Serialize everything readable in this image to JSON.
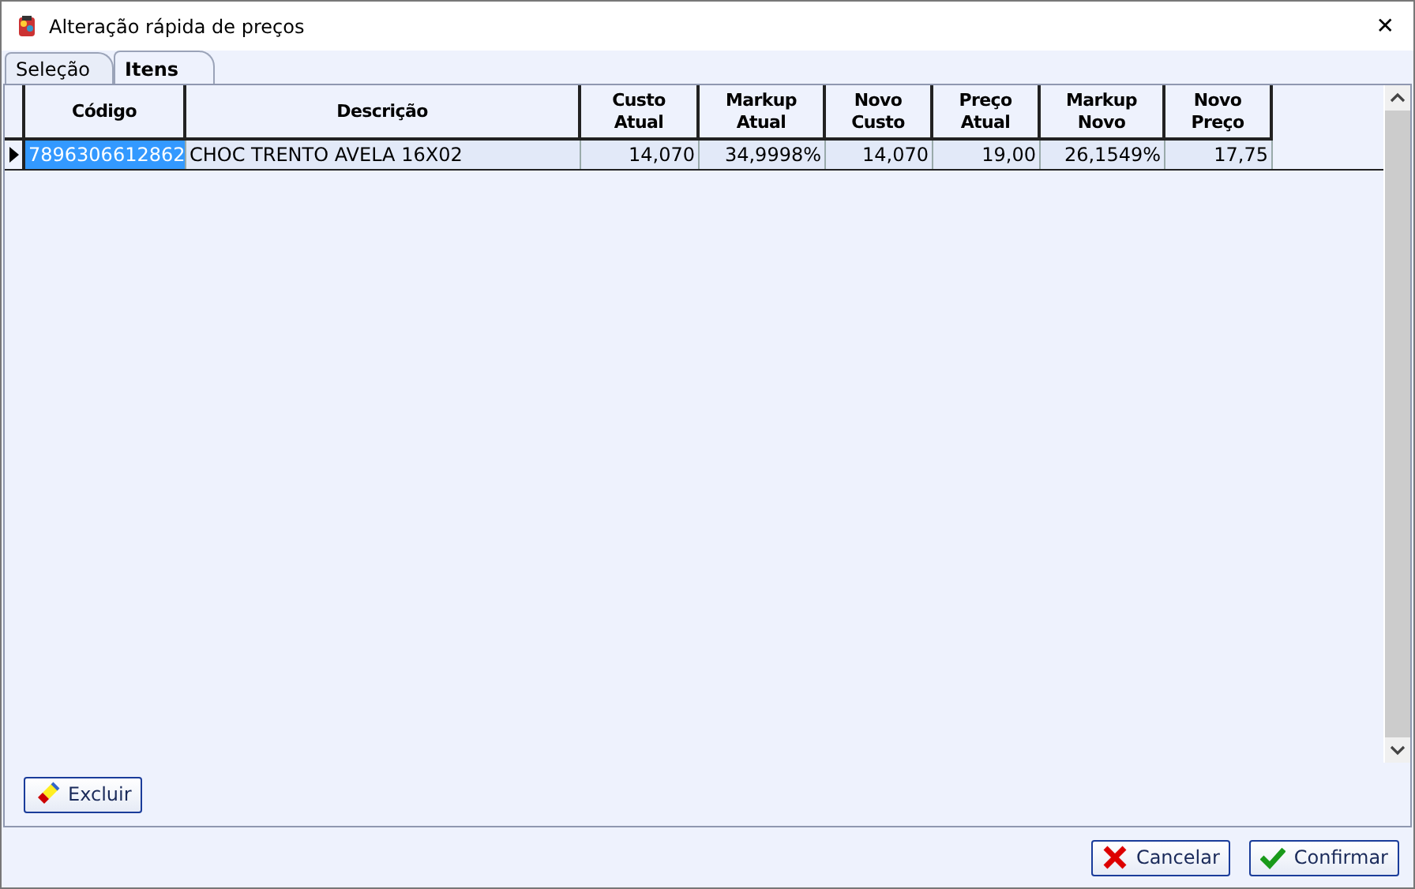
{
  "window": {
    "title": "Alteração rápida de preços",
    "close": "✕"
  },
  "tabs": [
    {
      "label": "Seleção",
      "selected": false
    },
    {
      "label": "Itens",
      "selected": true
    }
  ],
  "table": {
    "columns": [
      {
        "label": "Código"
      },
      {
        "label": "Descrição"
      },
      {
        "label": "Custo\nAtual"
      },
      {
        "label": "Markup Atual"
      },
      {
        "label": "Novo\nCusto"
      },
      {
        "label": "Preço\nAtual"
      },
      {
        "label": "Markup Novo"
      },
      {
        "label": "Novo\nPreço"
      }
    ],
    "rows": [
      {
        "selected": true,
        "cells": [
          "7896306612862",
          "CHOC TRENTO AVELA 16X02",
          "14,070",
          "34,9998%",
          "14,070",
          "19,00",
          "26,1549%",
          "17,75"
        ]
      }
    ]
  },
  "delete_button": {
    "label": "Excluir"
  },
  "buttons": [
    {
      "kind": "cancel",
      "label": "Cancelar"
    },
    {
      "kind": "confirm",
      "label": "Confirmar"
    }
  ]
}
